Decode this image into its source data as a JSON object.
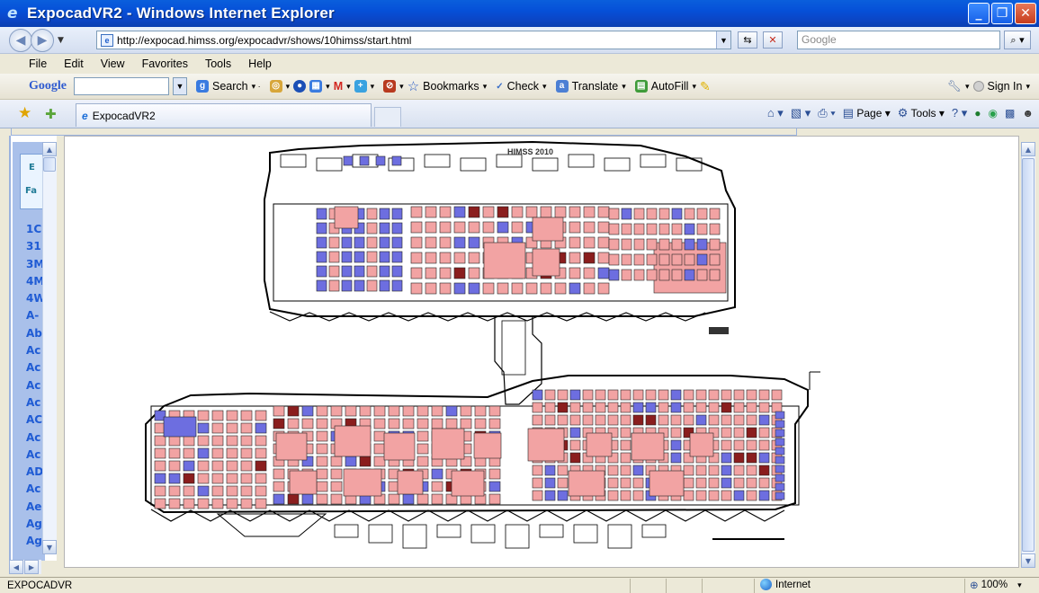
{
  "window": {
    "title": "ExpocadVR2 - Windows Internet Explorer",
    "controls": [
      "minimize",
      "maximize",
      "close"
    ]
  },
  "address_bar": {
    "url": "http://expocad.himss.org/expocadvr/shows/10himss/start.html",
    "search_placeholder": "Google"
  },
  "menu": {
    "items": [
      "File",
      "Edit",
      "View",
      "Favorites",
      "Tools",
      "Help"
    ]
  },
  "google_toolbar": {
    "logo": "Google",
    "search_label": "Search",
    "bookmarks_label": "Bookmarks",
    "check_label": "Check",
    "translate_label": "Translate",
    "autofill_label": "AutoFill",
    "signin_label": "Sign In"
  },
  "tabs": {
    "active_tab": "ExpocadVR2"
  },
  "command_bar": {
    "page_label": "Page",
    "tools_label": "Tools"
  },
  "left_pane": {
    "card_letters": [
      "E",
      "Fa"
    ],
    "items": [
      "1C",
      "31",
      "3M",
      "4M",
      "4W",
      "A-",
      "Ab",
      "Ac",
      "Ac",
      "Ac",
      "Ac",
      "AC",
      "Ac",
      "Ac",
      "AD",
      "Ac",
      "Ae",
      "Ag",
      "Ag"
    ]
  },
  "floorplan": {
    "header_label": "HIMSS 2010",
    "colors": {
      "booth_pink": "#f2a3a3",
      "booth_blue": "#6d6ee0",
      "booth_dark": "#8a1e1e",
      "outline": "#000000"
    }
  },
  "status_bar": {
    "status_text": "EXPOCADVR",
    "zone": "Internet",
    "zoom": "100%"
  }
}
